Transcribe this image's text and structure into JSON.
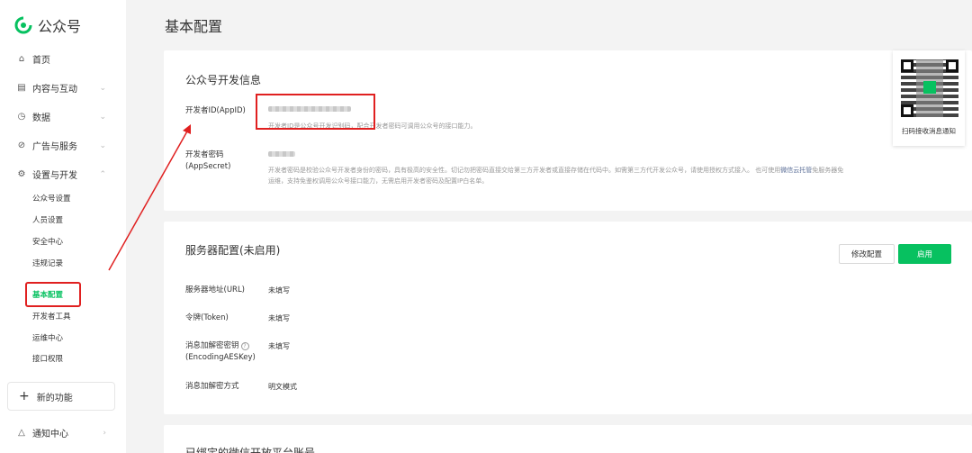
{
  "app": {
    "logo_text": "公众号",
    "brand_color": "#07c160"
  },
  "sidebar": {
    "home": "首页",
    "content": "内容与互动",
    "data": "数据",
    "ads": "广告与服务",
    "settings": "设置与开发",
    "sub": {
      "account": "公众号设置",
      "staff": "人员设置",
      "security": "安全中心",
      "violations": "违规记录",
      "basic": "基本配置",
      "devtools": "开发者工具",
      "ops": "运维中心",
      "api": "接口权限"
    },
    "new_func": "新的功能",
    "notify": "通知中心"
  },
  "page": {
    "title": "基本配置"
  },
  "dev_info": {
    "title": "公众号开发信息",
    "appid_label": "开发者ID(AppID)",
    "appid_desc": "开发者ID是公众号开发识别码，配合开发者密码可调用公众号的接口能力。",
    "secret_label": "开发者密码(AppSecret)",
    "secret_desc_1": "开发者密码是校验公众号开发者身份的密码，具有极高的安全性。切记勿把密码直接交给第三方开发者或直接存储在代码中。如需第三方代开发公众号，请使用授权方式接入。 也可使用",
    "secret_desc_link": "微信云托管",
    "secret_desc_2": "免服务器免",
    "secret_desc_3": "运维，支持免鉴权调用公众号接口能力，无需启用开发者密码及配置IP白名单。"
  },
  "server": {
    "title": "服务器配置(未启用)",
    "modify_btn": "修改配置",
    "enable_btn": "启用",
    "url_label": "服务器地址(URL)",
    "url_value": "未填写",
    "token_label": "令牌(Token)",
    "token_value": "未填写",
    "aes_label_1": "消息加解密密钥",
    "aes_label_2": "(EncodingAESKey)",
    "aes_value": "未填写",
    "mode_label": "消息加解密方式",
    "mode_value": "明文模式"
  },
  "bottom_card": {
    "title": "已绑定的微信开放平台账号"
  },
  "qr": {
    "caption": "扫码接收消息通知"
  }
}
